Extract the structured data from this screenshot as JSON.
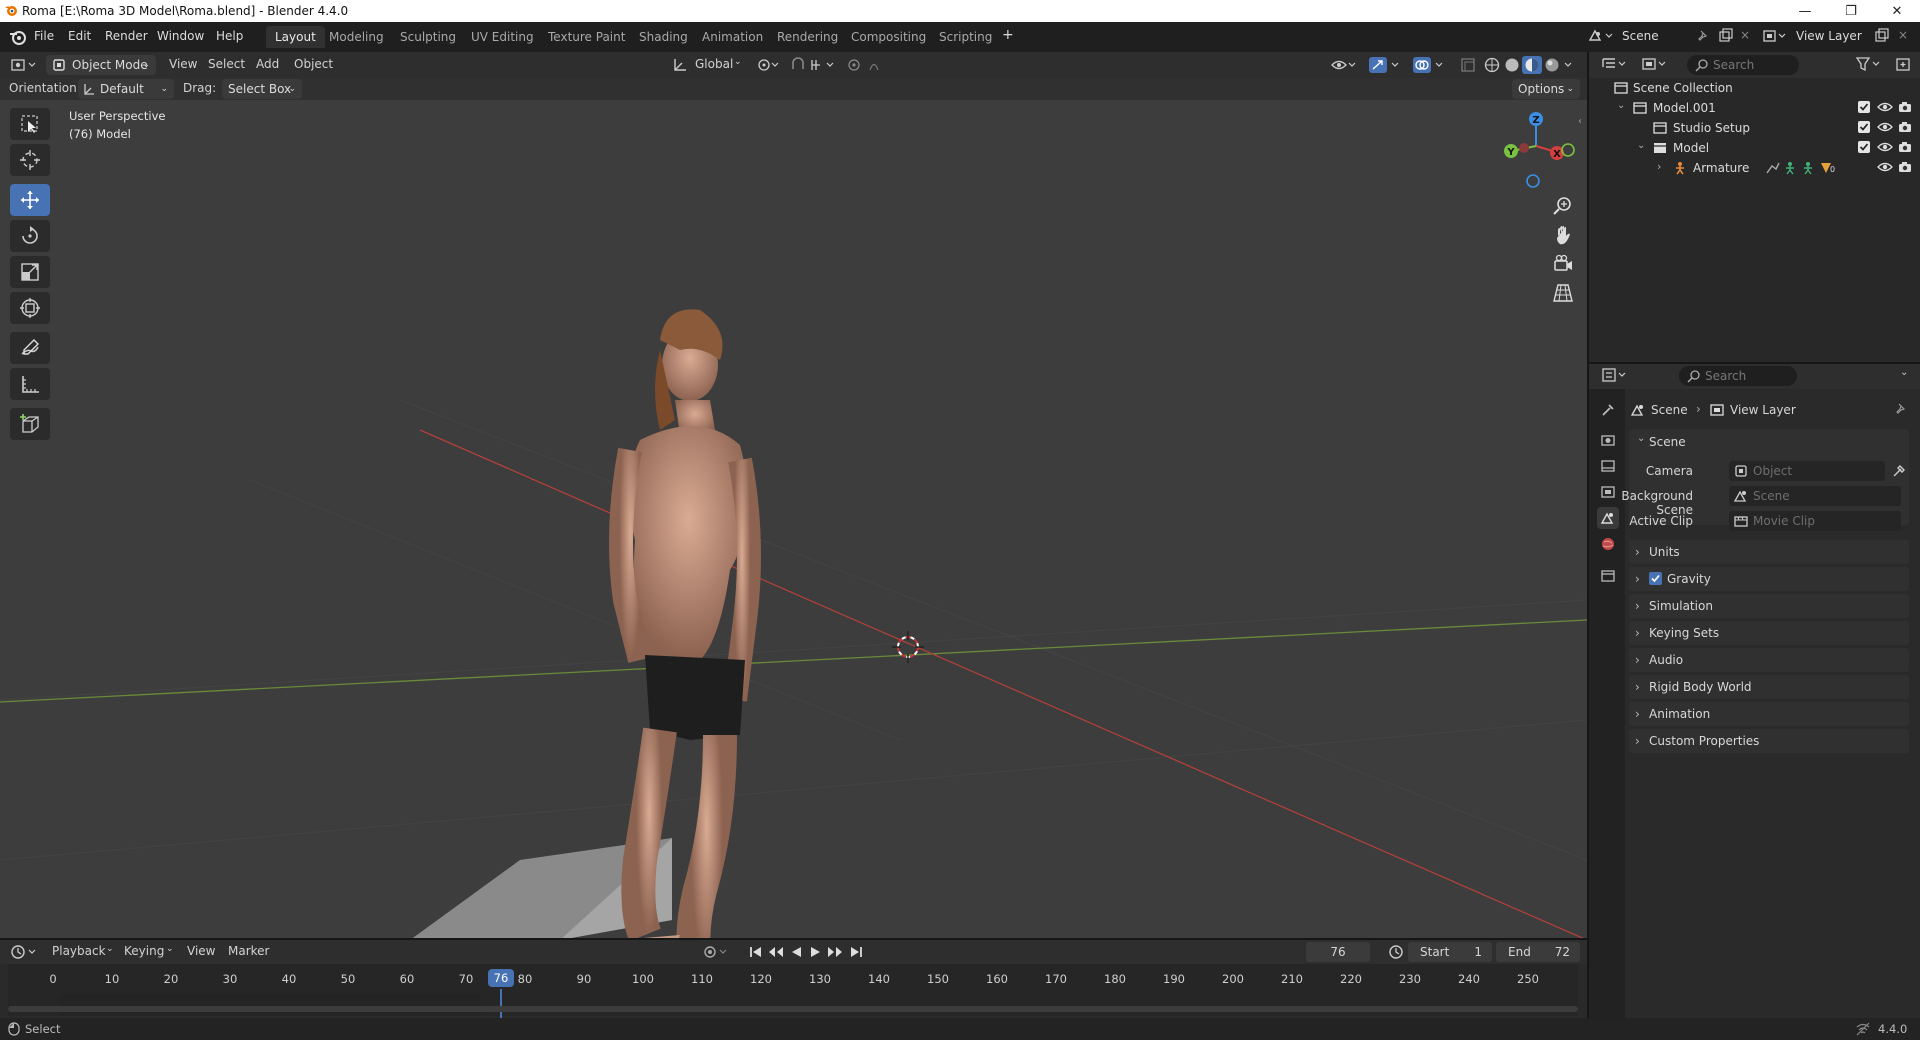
{
  "window": {
    "title": "Roma [E:\\Roma 3D Model\\Roma.blend] - Blender 4.4.0",
    "controls": {
      "minimize": "—",
      "maximize": "❐",
      "close": "✕"
    }
  },
  "menu": [
    "File",
    "Edit",
    "Render",
    "Window",
    "Help"
  ],
  "workspaces": [
    "Layout",
    "Modeling",
    "Sculpting",
    "UV Editing",
    "Texture Paint",
    "Shading",
    "Animation",
    "Rendering",
    "Compositing",
    "Scripting"
  ],
  "workspace_add": "+",
  "scene_selector": {
    "label": "Scene"
  },
  "view_layer_selector": {
    "label": "View Layer"
  },
  "viewport_header": {
    "mode": "Object Mode",
    "menus": [
      "View",
      "Select",
      "Add",
      "Object"
    ],
    "transform_orientation": "Global"
  },
  "tool_settings": {
    "orientation_label": "Orientation:",
    "orientation_value": "Default",
    "drag_label": "Drag:",
    "drag_value": "Select Box",
    "options": "Options"
  },
  "viewport": {
    "perspective": "User Perspective",
    "object": "(76) Model",
    "gizmo_axes": {
      "x": "X",
      "y": "Y",
      "z": "Z"
    }
  },
  "timeline": {
    "menus": [
      "Playback",
      "Keying",
      "View",
      "Marker"
    ],
    "current_frame": "76",
    "start_label": "Start",
    "start": "1",
    "end_label": "End",
    "end": "72",
    "ruler": [
      "0",
      "10",
      "20",
      "30",
      "40",
      "50",
      "60",
      "70",
      "80",
      "90",
      "100",
      "110",
      "120",
      "130",
      "140",
      "150",
      "160",
      "170",
      "180",
      "190",
      "200",
      "210",
      "220",
      "230",
      "240",
      "250"
    ],
    "playhead_label": "76"
  },
  "outliner": {
    "search_placeholder": "Search",
    "items": [
      {
        "label": "Scene Collection"
      },
      {
        "label": "Model.001"
      },
      {
        "label": "Studio Setup"
      },
      {
        "label": "Model"
      },
      {
        "label": "Armature",
        "badge": "0"
      }
    ]
  },
  "properties": {
    "search_placeholder": "Search",
    "breadcrumb": {
      "scene": "Scene",
      "view_layer": "View Layer"
    },
    "scene_panel_title": "Scene",
    "camera_label": "Camera",
    "camera_placeholder": "Object",
    "bg_scene_label": "Background Scene",
    "bg_scene_placeholder": "Scene",
    "active_clip_label": "Active Clip",
    "active_clip_placeholder": "Movie Clip",
    "panels": [
      "Units",
      "Gravity",
      "Simulation",
      "Keying Sets",
      "Audio",
      "Rigid Body World",
      "Animation",
      "Custom Properties"
    ]
  },
  "status": {
    "left": "Select",
    "version": "4.4.0"
  },
  "colors": {
    "accent": "#4772b3",
    "x_axis": "#d3403f",
    "y_axis": "#7ac142",
    "z_axis": "#3a8ee6"
  }
}
